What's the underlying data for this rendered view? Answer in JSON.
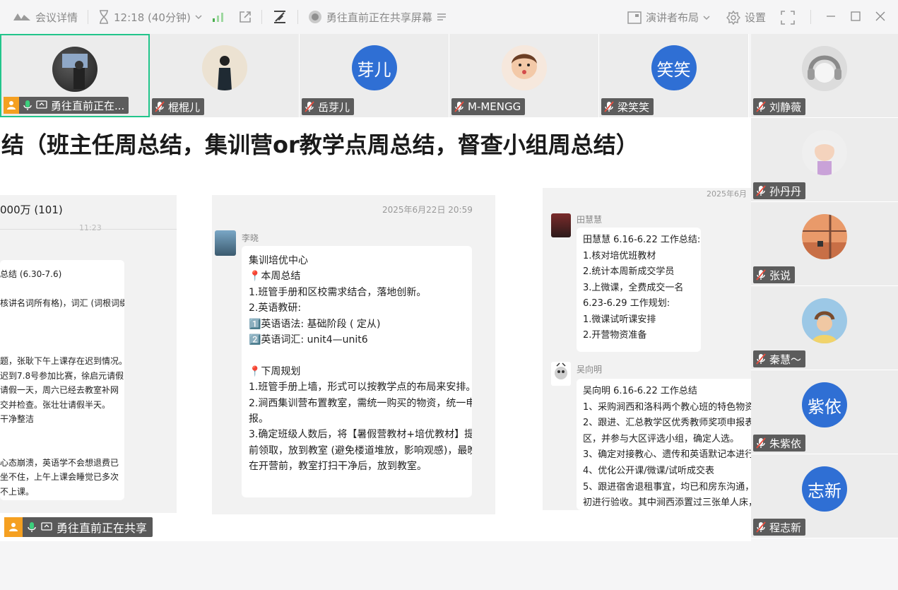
{
  "topbar": {
    "meeting_details": "会议详情",
    "timer": "12:18 (40分钟)",
    "sharing_status": "勇往直前正在共享屏幕",
    "layout_label": "演讲者布局",
    "settings_label": "设置"
  },
  "strip": [
    {
      "name": "勇往直前正在...",
      "avatar": "photo-dark"
    },
    {
      "name": "棍棍儿",
      "avatar": "photo-light"
    },
    {
      "name": "岳芽儿",
      "avatar_text": "芽儿"
    },
    {
      "name": "M-MENGG",
      "avatar": "photo-child"
    },
    {
      "name": "梁笑笑",
      "avatar_text": "笑笑"
    }
  ],
  "right": [
    {
      "name": "刘静薇",
      "avatar": "photo-headphone"
    },
    {
      "name": "孙丹丹",
      "avatar": "photo-baby"
    },
    {
      "name": "张说",
      "avatar": "photo-sunset"
    },
    {
      "name": "秦慧～",
      "avatar": "photo-sky"
    },
    {
      "name": "朱紫依",
      "avatar_text": "紫依"
    },
    {
      "name": "程志新",
      "avatar_text": "志新"
    }
  ],
  "share": {
    "title": "结（班主任周总结，集训营or教学点周总结，督查小组周总结）",
    "left_panel": {
      "header": "000万 (101)",
      "timestamp": "11:23",
      "text": "总结 (6.30-7.6)\n\n核讲名词所有格)，词汇 (词根词缀\n\n\n\n题，张耿下午上课存在迟到情况。\n迟到7.8号参加比赛，徐启元请假\n请假一天，周六已经去教室补网\n交并检查。张壮壮请假半天。\n干净整洁\n\n\n心态崩溃，英语学不会想退费已\n坐不住，上午上课会睡觉已多次\n不上课。"
    },
    "mid_panel": {
      "timestamp": "2025年6月22日 20:59",
      "sender": "李晓",
      "text": "集训培优中心\n📍本周总结\n1.班管手册和区校需求结合，落地创新。\n2.英语教研:\n1️⃣英语语法: 基础阶段 ( 定从)\n2️⃣英语词汇: unit4—unit6\n\n📍下周规划\n1.班管手册上墙，形式可以按教学点的布局来安排。\n2.涧西集训营布置教室，需统一购买的物资，统一申\n报。\n3.确定班级人数后，将【暑假营教材+培优教材】提\n前领取，放到教室 (避免楼道堆放，影响观感)，最晚\n在开营前，教室打扫干净后，放到教室。"
    },
    "right_panel": {
      "timestamp": "2025年6月",
      "sender1": "田慧慧",
      "text1": "田慧慧 6.16-6.22 工作总结:\n1.核对培优班教材\n2.统计本周新成交学员\n3.上微课，全费成交一名\n6.23-6.29 工作规划:\n1.微课试听课安排\n2.开营物资准备",
      "sender2": "吴向明",
      "text2": "吴向明 6.16-6.22 工作总结\n1、采购涧西和洛科两个教心班的特色物资，\n2、跟进、汇总教学区优秀教师奖项申报表，\n区，并参与大区评选小组，确定人选。\n3、确定对接教心、遗传和英语默记本进行E\n4、优化公开课/微课/试听成交表\n5、跟进宿舍退租事宜，均已和房东沟通，6\n初进行验收。其中涧西添置过三张单人床，"
    },
    "sharer_label": "勇往直前正在共享"
  }
}
